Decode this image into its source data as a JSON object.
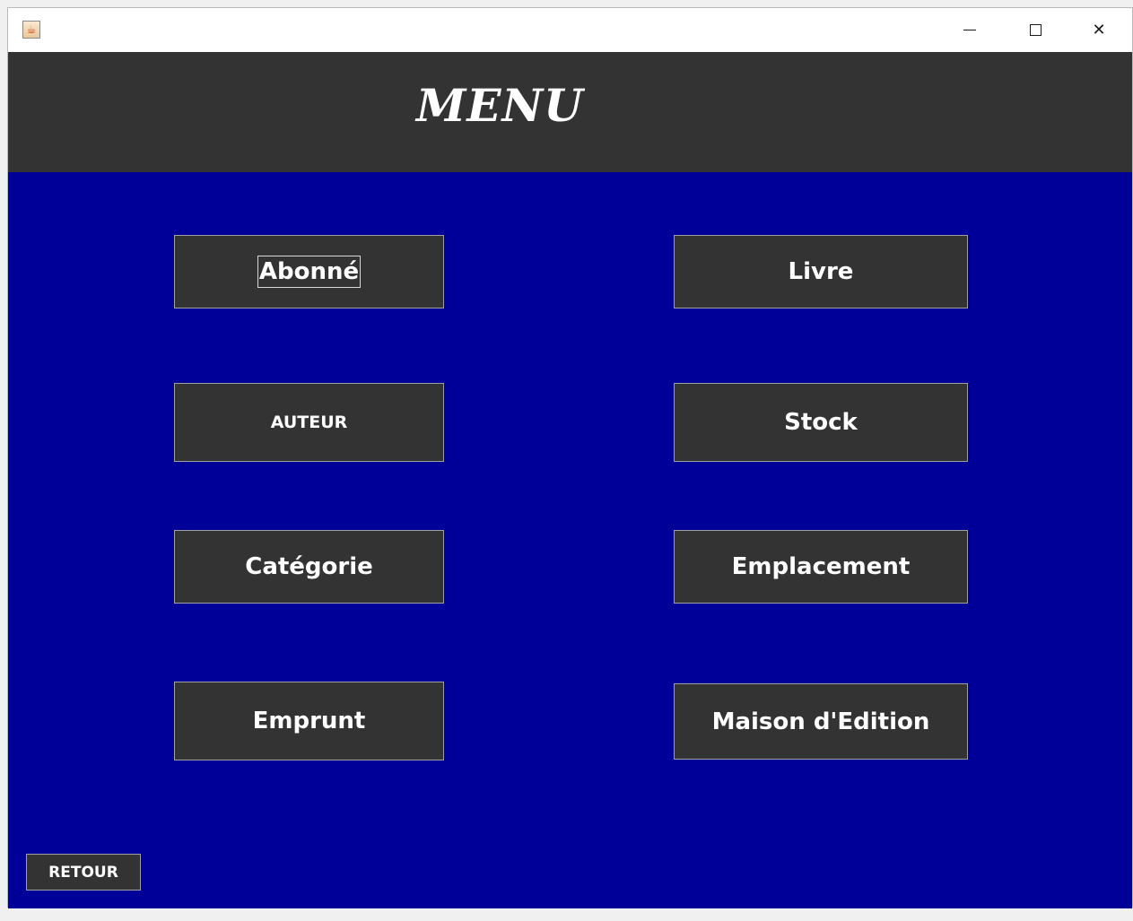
{
  "window": {
    "app_icon": "java-app-icon",
    "controls": {
      "minimize_icon": "minimize-icon",
      "maximize_icon": "maximize-icon",
      "close_icon": "close-icon",
      "close_glyph": "✕"
    }
  },
  "header": {
    "title": "MENU"
  },
  "menu": {
    "left": [
      {
        "label": "Abonné"
      },
      {
        "label": "AUTEUR"
      },
      {
        "label": "Catégorie"
      },
      {
        "label": "Emprunt"
      }
    ],
    "right": [
      {
        "label": "Livre"
      },
      {
        "label": "Stock"
      },
      {
        "label": "Emplacement"
      },
      {
        "label": "Maison d'Edition"
      }
    ]
  },
  "footer": {
    "retour_label": "RETOUR"
  },
  "colors": {
    "header_bg": "#333333",
    "content_bg": "#000099",
    "button_bg": "#333333",
    "button_text": "#ffffff"
  }
}
